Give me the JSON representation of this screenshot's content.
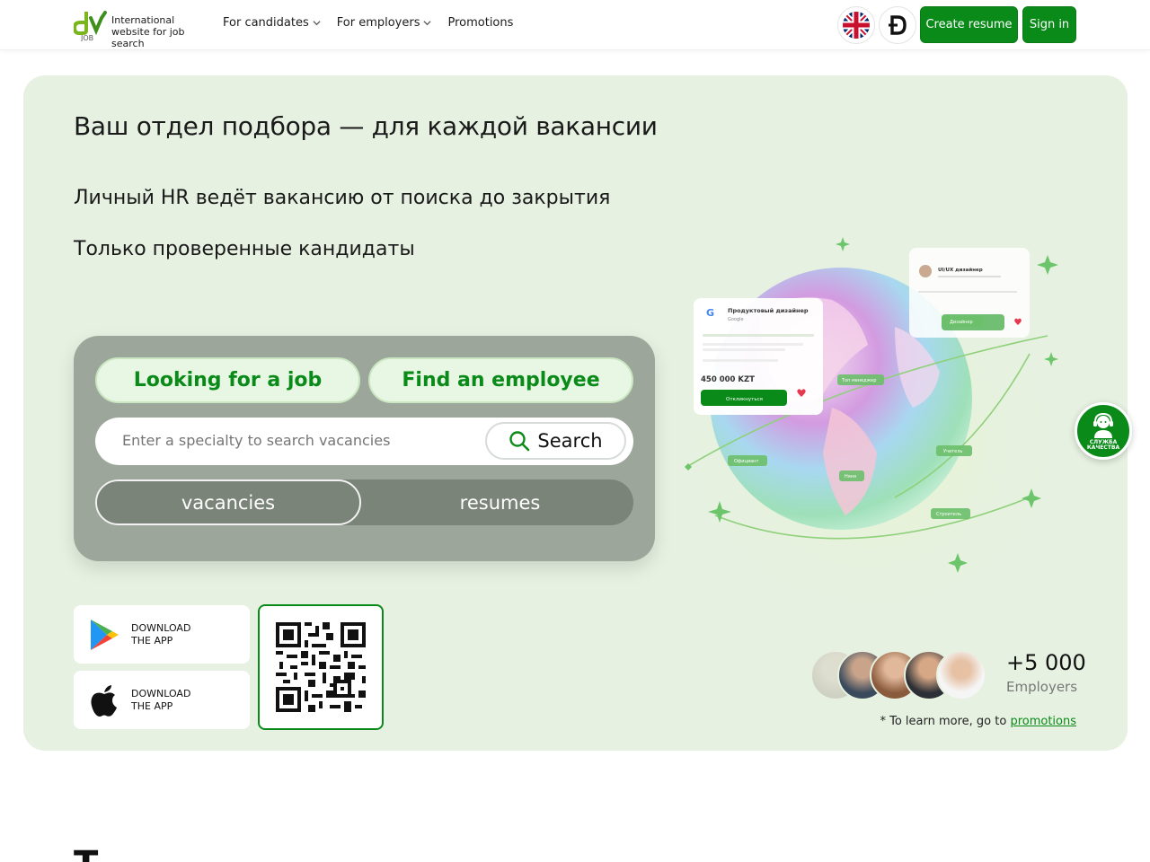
{
  "header": {
    "logo_tagline": "International website for job search",
    "logo_sub": "JOB",
    "nav": [
      {
        "label": "For candidates",
        "has_dropdown": true
      },
      {
        "label": "For employers",
        "has_dropdown": true
      },
      {
        "label": "Promotions",
        "has_dropdown": false
      }
    ],
    "language_icon": "uk-flag-icon",
    "currency_icon": "doge-coin-icon",
    "create_resume_label": "Create resume",
    "sign_in_label": "Sign in"
  },
  "hero": {
    "title": "Ваш отдел подбора — для каждой вакансии",
    "subtitle_1": "Личный HR ведёт вакансию от поиска до закрытия",
    "subtitle_2": "Только проверенные кандидаты",
    "mode_job_label": "Looking for a job",
    "mode_employee_label": "Find an employee",
    "search_placeholder": "Enter a specialty to search vacancies",
    "search_button_label": "Search",
    "toggle_vacancies_label": "vacancies",
    "toggle_resumes_label": "resumes",
    "store_google": {
      "line1": "DOWNLOAD",
      "line2": "THE APP"
    },
    "store_apple": {
      "line1": "DOWNLOAD",
      "line2": "THE APP"
    },
    "globe_card_1": {
      "title": "Продуктовый дизайнер",
      "company": "Google",
      "salary": "450 000 KZT",
      "button": "Откликнуться"
    },
    "globe_card_2": {
      "title": "UI/UX дизайнер"
    },
    "globe_tags": [
      "Дизайнер",
      "Топ менеджер",
      "Официант",
      "Учитель",
      "Няня",
      "Строитель"
    ],
    "stat_number": "+5 000",
    "stat_label": "Employers",
    "promo_note_prefix": "* To learn more, go to",
    "promo_note_link": "promotions"
  },
  "support_badge": {
    "line1": "СЛУЖБА",
    "line2": "КАЧЕСТВА"
  },
  "bottom_heading": "Т",
  "colors": {
    "brand_green": "#0a8a18",
    "hero_bg": "#e6f1e1",
    "search_card_bg": "#9da69a"
  }
}
